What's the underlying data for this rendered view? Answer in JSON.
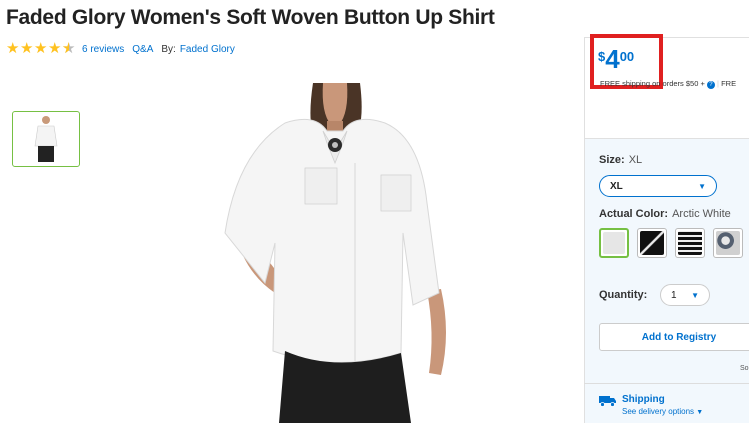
{
  "product": {
    "title": "Faded Glory Women's Soft Woven Button Up Shirt",
    "rating": 4.5,
    "reviews_label": "6 reviews",
    "qa_label": "Q&A",
    "by_label": "By:",
    "brand": "Faded Glory"
  },
  "price": {
    "currency": "$",
    "integer": "4",
    "decimal": "00",
    "free_shipping": "FREE shipping on orders $50 +",
    "free_shipping_tail": "FRE"
  },
  "size": {
    "label": "Size:",
    "value": "XL",
    "selected": "XL"
  },
  "color": {
    "label": "Actual Color:",
    "value": "Arctic White",
    "swatches": [
      {
        "name": "Arctic White",
        "color": "#e6e6e6"
      },
      {
        "name": "Black Stripe",
        "color": "#111111"
      },
      {
        "name": "Black Plaid",
        "color": "#222222"
      },
      {
        "name": "Floral",
        "color": "#556070"
      }
    ]
  },
  "quantity": {
    "label": "Quantity:",
    "value": "1"
  },
  "registry_button": "Add to Registry",
  "sold_by_fragment": "So",
  "shipping": {
    "title": "Shipping",
    "link": "See delivery options"
  },
  "icons": {
    "truck": "truck-icon",
    "help": "help-icon",
    "caret": "chevron-down-icon"
  },
  "colors": {
    "accent": "#0071ce",
    "star": "#ffc220",
    "highlight": "#e02020",
    "selected_border": "#76c043"
  }
}
